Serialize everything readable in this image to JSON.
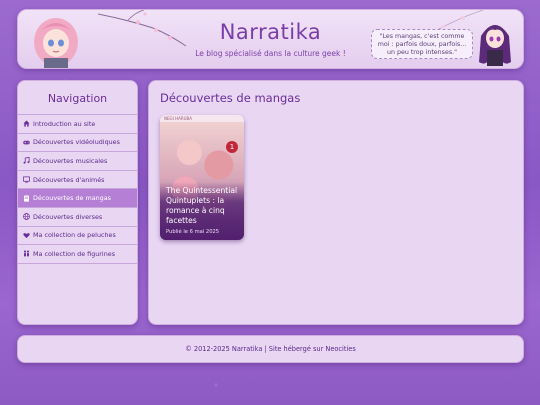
{
  "header": {
    "title": "Narratika",
    "subtitle": "Le blog spécialisé dans la culture geek !",
    "quote": "\"Les mangas, c'est comme moi : parfois doux, parfois... un peu trop intenses.\""
  },
  "sidebar": {
    "title": "Navigation",
    "items": [
      {
        "label": "Introduction au site",
        "icon": "home-icon",
        "active": false
      },
      {
        "label": "Découvertes vidéoludiques",
        "icon": "gamepad-icon",
        "active": false
      },
      {
        "label": "Découvertes musicales",
        "icon": "music-icon",
        "active": false
      },
      {
        "label": "Découvertes d'animés",
        "icon": "tv-icon",
        "active": false
      },
      {
        "label": "Découvertes de mangas",
        "icon": "book-icon",
        "active": true
      },
      {
        "label": "Découvertes diverses",
        "icon": "globe-icon",
        "active": false
      },
      {
        "label": "Ma collection de peluches",
        "icon": "heart-icon",
        "active": false
      },
      {
        "label": "Ma collection de figurines",
        "icon": "people-icon",
        "active": false
      }
    ]
  },
  "main": {
    "heading": "Découvertes de mangas",
    "cards": [
      {
        "title": "The Quintessential Quintuplets : la romance à cinq facettes",
        "date": "Publié le 6 mai 2025",
        "cover_top_text": "NEGI HARUBA",
        "volume": "1"
      }
    ]
  },
  "footer": {
    "text": "© 2012-2025 Narratika | Site hébergé sur Neocities"
  },
  "colors": {
    "accent": "#b47fd4",
    "title": "#7a3da8",
    "panel": "#e9d6f3",
    "background": "#8a58c4"
  }
}
